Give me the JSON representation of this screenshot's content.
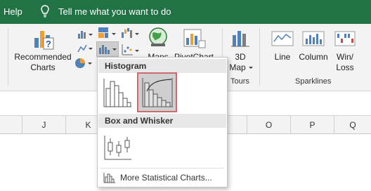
{
  "topbar": {
    "help": "Help",
    "tell_me": "Tell me what you want to do"
  },
  "ribbon": {
    "recommended_charts": [
      "Recommended",
      "Charts"
    ],
    "maps": "Maps",
    "pivotchart": "PivotChart",
    "map3d": [
      "3D",
      "Map"
    ],
    "tours_group": "Tours",
    "line": "Line",
    "column": "Column",
    "winloss": [
      "Win/",
      "Loss"
    ],
    "sparklines_group": "Sparklines"
  },
  "columns": [
    "J",
    "K",
    "",
    "",
    "",
    "",
    "O",
    "P",
    "Q"
  ],
  "dropdown": {
    "histogram_header": "Histogram",
    "box_whisker_header": "Box and Whisker",
    "more": "More Statistical Charts..."
  },
  "colors": {
    "excel_green": "#217346",
    "selection_border": "#cc6b6b"
  }
}
